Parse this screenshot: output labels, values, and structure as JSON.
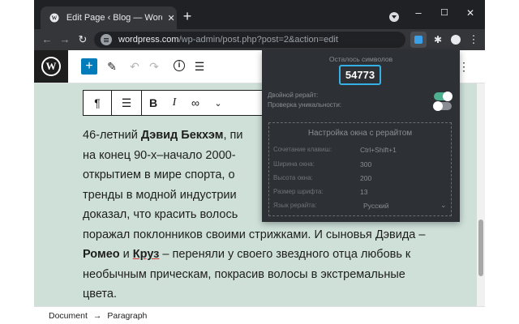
{
  "browser": {
    "tab_title": "Edit Page ‹ Blog — WordPress",
    "tab_close": "✕",
    "new_tab": "+",
    "url_host": "wordpress.com",
    "url_path": "/wp-admin/post.php?post=2&action=edit",
    "window_min": "–",
    "window_max": "☐",
    "window_close": "✕"
  },
  "editor": {
    "paragraph": {
      "lines": [
        {
          "a": "46-летний ",
          "b": "Дэвид Бекхэм",
          "c": ", пи"
        },
        {
          "a": "на конец 90-х–начало 2000-"
        },
        {
          "a": "открытием в мире спорта, о"
        },
        {
          "a": "тренды в модной индустрии"
        },
        {
          "a": "доказал, что красить волось"
        },
        {
          "a": "поражал поклонников своими стрижками. И сыновья Дэвида –"
        },
        {
          "a": "Ромео",
          "b": " и ",
          "c": "Круз",
          "d": " – переняли у своего звездного отца любовь к"
        },
        {
          "a": "необычным прическам, покрасив волосы в экстремальные"
        },
        {
          "a": "цвета."
        }
      ]
    },
    "footer": {
      "crumb_document": "Document",
      "crumb_sep": "→",
      "crumb_paragraph": "Paragraph"
    }
  },
  "extension_popup": {
    "title": "Осталось символов",
    "counter": "54773",
    "option_double_rewrite": "Двойной рерайт:",
    "option_uniqueness_check": "Проверка уникальности:",
    "double_rewrite_on": true,
    "uniqueness_check_on": false,
    "settings": {
      "title": "Настройка окна с рерайтом",
      "rows": [
        {
          "key": "Сочетание клавиш:",
          "value": "Ctrl+Shift+1"
        },
        {
          "key": "Ширина окна:",
          "value": "300"
        },
        {
          "key": "Высота окна:",
          "value": "200"
        },
        {
          "key": "Размер шрифта:",
          "value": "13"
        },
        {
          "key": "Язык рерайта:",
          "value": "Русский"
        }
      ]
    }
  },
  "colors": {
    "content_bg": "#cfe0d9",
    "accent_blue": "#007cba",
    "counter_border": "#35b0e6",
    "toggle_on": "#4caf8d"
  }
}
